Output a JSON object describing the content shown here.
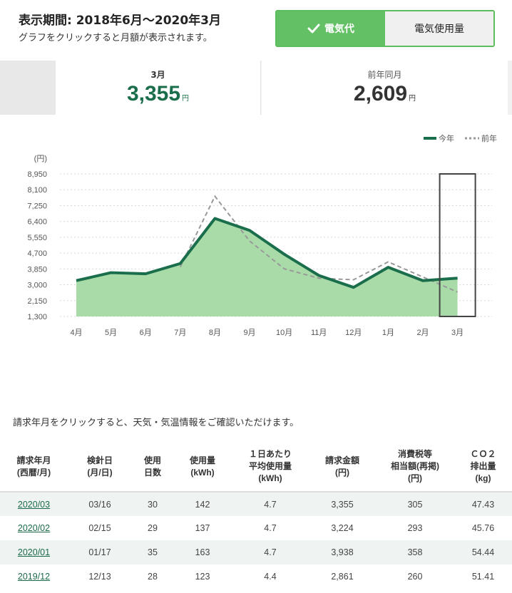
{
  "header": {
    "title": "表示期間: 2018年6月～2020年3月",
    "hint": "グラフをクリックすると月額が表示されます。"
  },
  "toggle": {
    "fee_label": "電気代",
    "usage_label": "電気使用量",
    "active": "fee"
  },
  "summary": {
    "current": {
      "label": "3月",
      "value": "3,355",
      "unit": "円"
    },
    "previous": {
      "label": "前年同月",
      "value": "2,609",
      "unit": "円"
    }
  },
  "chart_data": {
    "type": "area",
    "ylabel": "(円)",
    "ylim": [
      1300,
      8950
    ],
    "yticks": [
      "1,300",
      "2,150",
      "3,000",
      "3,850",
      "4,700",
      "5,550",
      "6,400",
      "7,250",
      "8,100",
      "8,950"
    ],
    "categories": [
      "4月",
      "5月",
      "6月",
      "7月",
      "8月",
      "9月",
      "10月",
      "11月",
      "12月",
      "1月",
      "2月",
      "3月"
    ],
    "series": [
      {
        "name": "今年",
        "style": "solid-area",
        "color": "#1b6e4b",
        "fill": "#a9dba9",
        "values": [
          3224,
          3650,
          3590,
          4140,
          6560,
          5920,
          4640,
          3500,
          2861,
          3938,
          3224,
          3355
        ]
      },
      {
        "name": "前年",
        "style": "dashed",
        "color": "#999999",
        "values": [
          null,
          null,
          null,
          3950,
          7750,
          5350,
          3860,
          3350,
          3270,
          4230,
          3420,
          2609
        ]
      }
    ],
    "highlight_index": 11,
    "legend": "top-right",
    "grid": true
  },
  "info_text": "請求年月をクリックすると、天気・気温情報をご確認いただけます。",
  "table": {
    "headers": [
      "請求年月\n(西暦/月)",
      "検針日\n(月/日)",
      "使用\n日数",
      "使用量\n(kWh)",
      "１日あたり\n平均使用量\n(kWh)",
      "請求金額\n(円)",
      "消費税等\n相当額(再掲)\n(円)",
      "ＣＯ２\n排出量\n(kg)"
    ],
    "rows": [
      [
        "2020/03",
        "03/16",
        "30",
        "142",
        "4.7",
        "3,355",
        "305",
        "47.43"
      ],
      [
        "2020/02",
        "02/15",
        "29",
        "137",
        "4.7",
        "3,224",
        "293",
        "45.76"
      ],
      [
        "2020/01",
        "01/17",
        "35",
        "163",
        "4.7",
        "3,938",
        "358",
        "54.44"
      ],
      [
        "2019/12",
        "12/13",
        "28",
        "123",
        "4.4",
        "2,861",
        "260",
        "51.41"
      ]
    ]
  }
}
